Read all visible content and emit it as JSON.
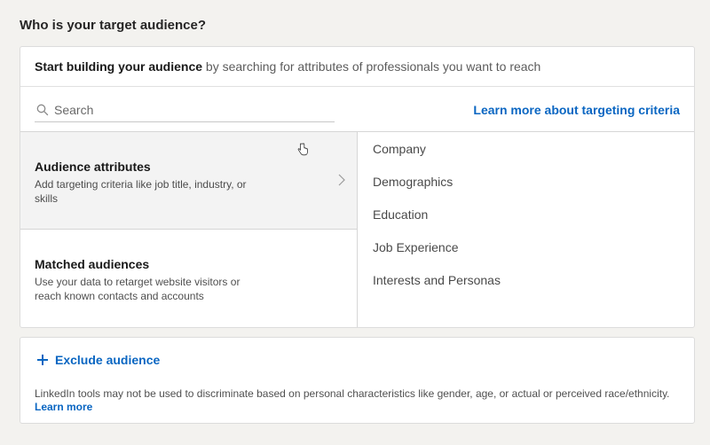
{
  "section_title": "Who is your target audience?",
  "header": {
    "bold": "Start building your audience",
    "rest": " by searching for attributes of professionals you want to reach"
  },
  "search": {
    "placeholder": "Search",
    "value": ""
  },
  "learn_targeting_link": "Learn more about targeting criteria",
  "options": [
    {
      "title": "Audience attributes",
      "description": "Add targeting criteria like job title, industry, or skills",
      "selected": true
    },
    {
      "title": "Matched audiences",
      "description": "Use your data to retarget website visitors or reach known contacts and accounts",
      "selected": false
    }
  ],
  "categories": [
    "Company",
    "Demographics",
    "Education",
    "Job Experience",
    "Interests and Personas"
  ],
  "exclude": {
    "label": "Exclude audience",
    "icon": "plus-icon"
  },
  "disclaimer": "LinkedIn tools may not be used to discriminate based on personal characteristics like gender, age, or actual or perceived race/ethnicity.",
  "learn_more": "Learn more",
  "colors": {
    "link": "#0a66c2",
    "background": "#f3f2ef",
    "selected_row": "#f3f3f3"
  }
}
